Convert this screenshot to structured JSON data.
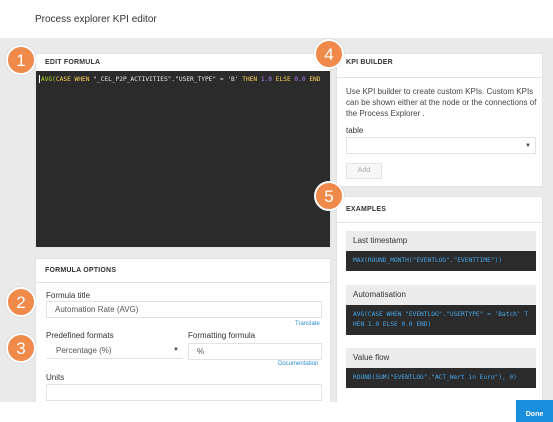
{
  "header": {
    "title": "Process explorer KPI editor"
  },
  "edit_formula": {
    "heading": "EDIT FORMULA",
    "tokens": [
      {
        "t": "AVG(",
        "c": "fn"
      },
      {
        "t": "CASE WHEN ",
        "c": "kw"
      },
      {
        "t": "\"_CEL_P2P_ACTIVITIES\"",
        "c": "str"
      },
      {
        "t": ".",
        "c": "op"
      },
      {
        "t": "\"USER_TYPE\"",
        "c": "str"
      },
      {
        "t": " = ",
        "c": "op"
      },
      {
        "t": "'B'",
        "c": "str"
      },
      {
        "t": " THEN ",
        "c": "kw"
      },
      {
        "t": "1.0",
        "c": "num"
      },
      {
        "t": " ELSE ",
        "c": "kw"
      },
      {
        "t": "0.0",
        "c": "num"
      },
      {
        "t": " END",
        "c": "kw"
      }
    ]
  },
  "formula_options": {
    "heading": "FORMULA OPTIONS",
    "title_label": "Formula title",
    "title_value": "Automation Rate (AVG)",
    "translate_link": "Translate",
    "predefined_label": "Predefined formats",
    "predefined_value": "Percentage (%)",
    "formatting_label": "Formatting formula",
    "formatting_value": "%",
    "documentation_link": "Documentation",
    "units_label": "Units"
  },
  "kpi_builder": {
    "heading": "KPI BUILDER",
    "description": "Use KPI builder to create custom KPIs. Custom KPIs can be shown either at the node or the connections of the Process Explorer .",
    "table_label": "table",
    "add_label": "Add"
  },
  "examples": {
    "heading": "EXAMPLES",
    "items": [
      {
        "title": "Last timestamp",
        "code": "MAX(ROUND_MONTH(\"EVENTLOG\".\"EVENTTIME\"))"
      },
      {
        "title": "Automatisation",
        "code": "AVG(CASE WHEN \"EVENTLOG\".\"USERTYPE\" = 'Batch' THEN 1.0 ELSE 0.0 END)"
      },
      {
        "title": "Value flow",
        "code": "ROUND(SUM(\"EVENTLOG\".\"ACT_Wert in Euro\"), 0)"
      }
    ]
  },
  "badges": [
    "1",
    "2",
    "3",
    "4",
    "5"
  ],
  "footer": {
    "done_label": "Done"
  },
  "colors": {
    "badge": "#ef8a4b",
    "accent": "#1a8fdd",
    "editor_bg": "#2b2b2b"
  }
}
